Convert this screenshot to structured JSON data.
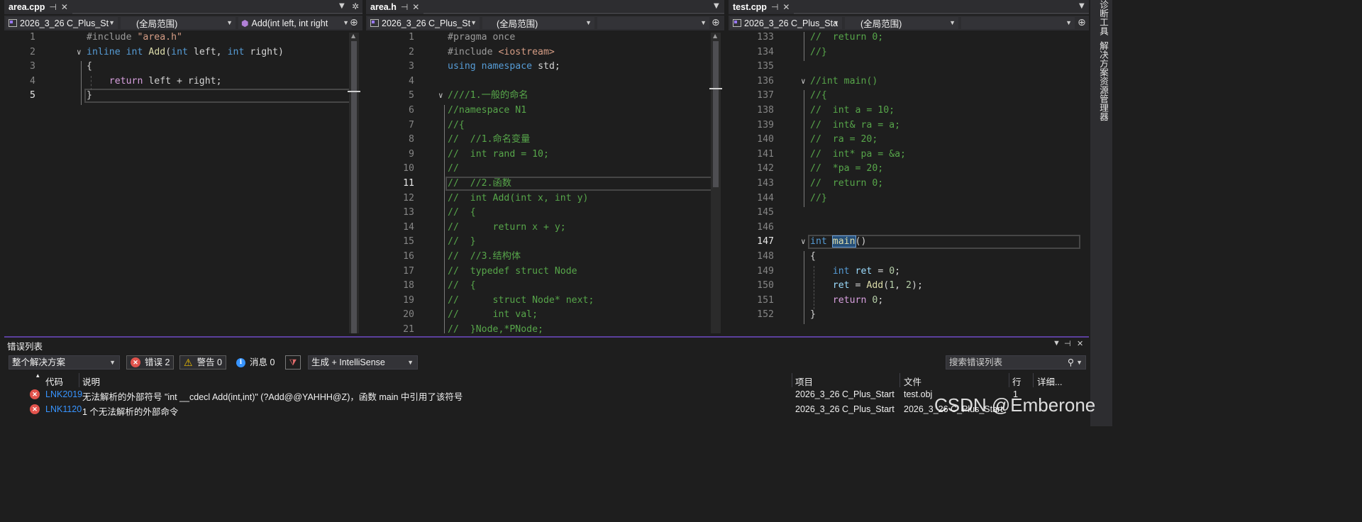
{
  "panes": [
    {
      "tab": "area.cpp",
      "nav": {
        "project": "2026_3_26 C_Plus_St",
        "scope": "(全局范围)",
        "member": "Add(int left, int right"
      },
      "lines": [
        {
          "n": "1",
          "code": [
            [
              "t-pp",
              "#include "
            ],
            [
              "t-str",
              "\"area.h\""
            ]
          ]
        },
        {
          "n": "2",
          "fold": true,
          "code": [
            [
              "t-kw",
              "inline"
            ],
            [
              "",
              " "
            ],
            [
              "t-kw",
              "int"
            ],
            [
              "",
              " "
            ],
            [
              "t-fn",
              "Add"
            ],
            [
              "",
              "("
            ],
            [
              "t-kw",
              "int"
            ],
            [
              "",
              " left, "
            ],
            [
              "t-kw",
              "int"
            ],
            [
              "",
              " right)"
            ]
          ]
        },
        {
          "n": "3",
          "code": [
            [
              "",
              "{"
            ]
          ]
        },
        {
          "n": "4",
          "code": [
            [
              "",
              "    "
            ],
            [
              "t-ctl",
              "return"
            ],
            [
              "",
              " left + right;"
            ]
          ]
        },
        {
          "n": "5",
          "current": true,
          "code": [
            [
              "",
              "}"
            ]
          ]
        }
      ]
    },
    {
      "tab": "area.h",
      "nav": {
        "project": "2026_3_26 C_Plus_St",
        "scope": "(全局范围)",
        "member": ""
      },
      "lines": [
        {
          "n": "1",
          "code": [
            [
              "t-pp",
              "#pragma once"
            ]
          ]
        },
        {
          "n": "2",
          "code": [
            [
              "t-pp",
              "#include "
            ],
            [
              "t-str",
              "<iostream>"
            ]
          ]
        },
        {
          "n": "3",
          "code": [
            [
              "t-kw",
              "using"
            ],
            [
              "",
              " "
            ],
            [
              "t-kw",
              "namespace"
            ],
            [
              "",
              " std;"
            ]
          ]
        },
        {
          "n": "4",
          "code": []
        },
        {
          "n": "5",
          "fold": true,
          "code": [
            [
              "t-cm",
              "////1.一般的命名"
            ]
          ]
        },
        {
          "n": "6",
          "code": [
            [
              "t-cm",
              "//namespace N1"
            ]
          ]
        },
        {
          "n": "7",
          "code": [
            [
              "t-cm",
              "//{"
            ]
          ]
        },
        {
          "n": "8",
          "code": [
            [
              "t-cm",
              "//  //1.命名变量"
            ]
          ]
        },
        {
          "n": "9",
          "code": [
            [
              "t-cm",
              "//  int rand = 10;"
            ]
          ]
        },
        {
          "n": "10",
          "code": [
            [
              "t-cm",
              "//"
            ]
          ]
        },
        {
          "n": "11",
          "current": true,
          "code": [
            [
              "t-cm",
              "//  //2.函数"
            ]
          ]
        },
        {
          "n": "12",
          "code": [
            [
              "t-cm",
              "//  int Add(int x, int y)"
            ]
          ]
        },
        {
          "n": "13",
          "code": [
            [
              "t-cm",
              "//  {"
            ]
          ]
        },
        {
          "n": "14",
          "code": [
            [
              "t-cm",
              "//      return x + y;"
            ]
          ]
        },
        {
          "n": "15",
          "code": [
            [
              "t-cm",
              "//  }"
            ]
          ]
        },
        {
          "n": "16",
          "code": [
            [
              "t-cm",
              "//  //3.结构体"
            ]
          ]
        },
        {
          "n": "17",
          "code": [
            [
              "t-cm",
              "//  typedef struct Node"
            ]
          ]
        },
        {
          "n": "18",
          "code": [
            [
              "t-cm",
              "//  {"
            ]
          ]
        },
        {
          "n": "19",
          "code": [
            [
              "t-cm",
              "//      struct Node* next;"
            ]
          ]
        },
        {
          "n": "20",
          "code": [
            [
              "t-cm",
              "//      int val;"
            ]
          ]
        },
        {
          "n": "21",
          "code": [
            [
              "t-cm",
              "//  }Node,*PNode;"
            ]
          ]
        }
      ]
    },
    {
      "tab": "test.cpp",
      "nav": {
        "project": "2026_3_26 C_Plus_Sta",
        "scope": "(全局范围)",
        "member": ""
      },
      "lines": [
        {
          "n": "133",
          "code": [
            [
              "t-cm",
              "//  return 0;"
            ]
          ]
        },
        {
          "n": "134",
          "code": [
            [
              "t-cm",
              "//}"
            ]
          ]
        },
        {
          "n": "135",
          "code": []
        },
        {
          "n": "136",
          "fold": true,
          "code": [
            [
              "t-cm",
              "//int main()"
            ]
          ]
        },
        {
          "n": "137",
          "code": [
            [
              "t-cm",
              "//{"
            ]
          ]
        },
        {
          "n": "138",
          "code": [
            [
              "t-cm",
              "//  int a = 10;"
            ]
          ]
        },
        {
          "n": "139",
          "code": [
            [
              "t-cm",
              "//  int& ra = a;"
            ]
          ]
        },
        {
          "n": "140",
          "code": [
            [
              "t-cm",
              "//  ra = 20;"
            ]
          ]
        },
        {
          "n": "141",
          "code": [
            [
              "t-cm",
              "//  int* pa = &a;"
            ]
          ]
        },
        {
          "n": "142",
          "code": [
            [
              "t-cm",
              "//  *pa = 20;"
            ]
          ]
        },
        {
          "n": "143",
          "code": [
            [
              "t-cm",
              "//  return 0;"
            ]
          ]
        },
        {
          "n": "144",
          "code": [
            [
              "t-cm",
              "//}"
            ]
          ]
        },
        {
          "n": "145",
          "code": []
        },
        {
          "n": "146",
          "code": []
        },
        {
          "n": "147",
          "fold": true,
          "current": true,
          "code": [
            [
              "t-kw",
              "int"
            ],
            [
              "",
              " "
            ],
            [
              "t-fn t-sel",
              "main"
            ],
            [
              "",
              "()"
            ]
          ]
        },
        {
          "n": "148",
          "code": [
            [
              "",
              "{"
            ]
          ]
        },
        {
          "n": "149",
          "code": [
            [
              "",
              "    "
            ],
            [
              "t-kw",
              "int"
            ],
            [
              "",
              " "
            ],
            [
              "t-var",
              "ret"
            ],
            [
              "",
              " = "
            ],
            [
              "t-num",
              "0"
            ],
            [
              "",
              ";"
            ]
          ]
        },
        {
          "n": "150",
          "code": [
            [
              "",
              "    "
            ],
            [
              "t-var",
              "ret"
            ],
            [
              "",
              " = "
            ],
            [
              "t-fn",
              "Add"
            ],
            [
              "",
              "("
            ],
            [
              "t-num",
              "1"
            ],
            [
              "",
              ", "
            ],
            [
              "t-num",
              "2"
            ],
            [
              "",
              ");"
            ]
          ]
        },
        {
          "n": "151",
          "code": [
            [
              "",
              "    "
            ],
            [
              "t-ctl",
              "return"
            ],
            [
              "",
              " "
            ],
            [
              "t-num",
              "0"
            ],
            [
              "",
              ";"
            ]
          ]
        },
        {
          "n": "152",
          "code": [
            [
              "",
              "}"
            ]
          ]
        }
      ]
    }
  ],
  "right_rail": {
    "items": [
      "诊断工具",
      "解决方案资源管理器"
    ]
  },
  "error_list": {
    "title": "错误列表",
    "scope_select": "整个解决方案",
    "errors_filter": "错误 2",
    "warnings_filter": "警告 0",
    "messages_filter": "消息 0",
    "build_select": "生成 + IntelliSense",
    "search_placeholder": "搜索错误列表",
    "columns": {
      "code": "代码",
      "desc": "说明",
      "project": "项目",
      "file": "文件",
      "line": "行",
      "detail": "详细..."
    },
    "rows": [
      {
        "code": "LNK2019",
        "desc": "无法解析的外部符号 \"int __cdecl Add(int,int)\" (?Add@@YAHHH@Z)，函数 main 中引用了该符号",
        "project": "2026_3_26 C_Plus_Start",
        "file": "test.obj",
        "line": "1"
      },
      {
        "code": "LNK1120",
        "desc": "1 个无法解析的外部命令",
        "project": "2026_3_26 C_Plus_Start",
        "file": "2026_3_26 C_Plus_Start",
        "line": ""
      }
    ]
  },
  "watermark": "CSDN @Emberone",
  "colors": {
    "accent": "#5b3f9c",
    "error": "#e2534c",
    "warning": "#f0c000",
    "info": "#3794ff",
    "comment": "#57a64a",
    "keyword": "#569cd6"
  }
}
